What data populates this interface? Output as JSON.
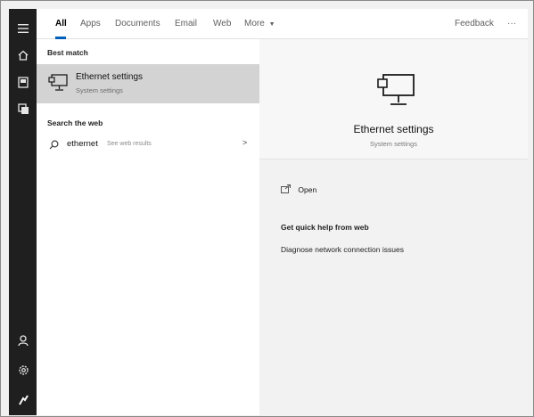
{
  "tabs": {
    "all": "All",
    "apps": "Apps",
    "documents": "Documents",
    "email": "Email",
    "web": "Web",
    "more": "More",
    "feedback": "Feedback",
    "ellipsis": "···"
  },
  "left": {
    "best_match_title": "Best match",
    "best_match": {
      "title": "Ethernet settings",
      "subtitle": "System settings",
      "icon": "ethernet-monitor-icon"
    },
    "search_web_title": "Search the web",
    "web_result": {
      "query": "ethernet",
      "hint": "See web results",
      "icon": "search-icon"
    }
  },
  "right": {
    "title": "Ethernet settings",
    "subtitle": "System settings",
    "open_label": "Open",
    "quick_help_title": "Get quick help from web",
    "quick_help_link": "Diagnose network connection issues"
  },
  "rail": {
    "icons": [
      "hamburger-icon",
      "home-icon",
      "documents-icon",
      "photos-icon",
      "user-icon",
      "settings-icon",
      "user-photo-icon"
    ]
  },
  "colors": {
    "rail": "#1f1f1f",
    "selected_row": "#d3d3d3",
    "accent": "#005fb8"
  }
}
